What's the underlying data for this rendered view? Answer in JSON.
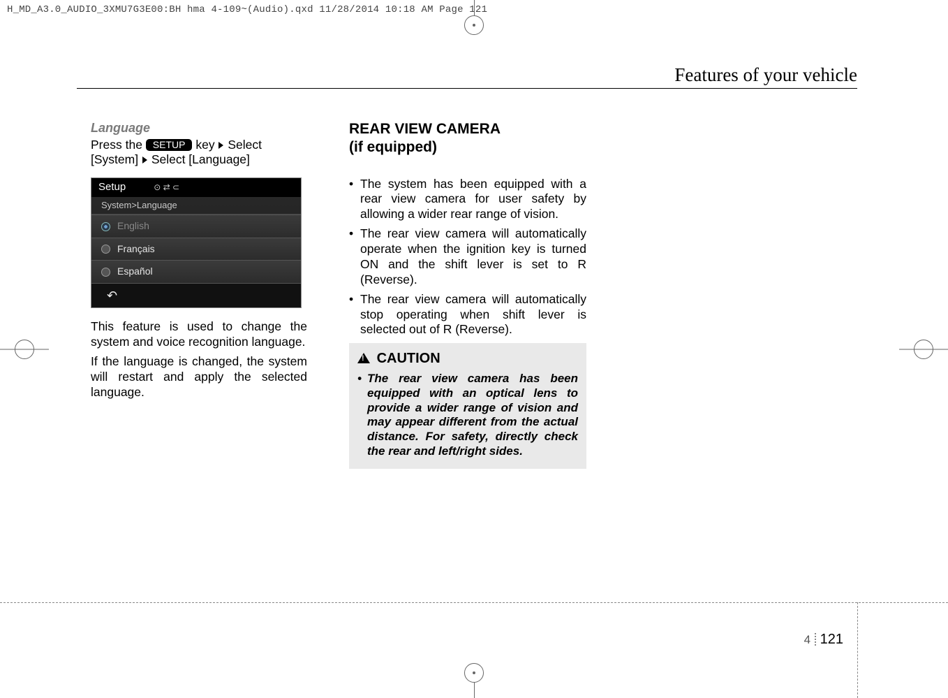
{
  "file_header": "H_MD_A3.0_AUDIO_3XMU7G3E00:BH hma 4-109~(Audio).qxd  11/28/2014  10:18 AM  Page 121",
  "section_title": "Features of your vehicle",
  "col1": {
    "lang_heading": "Language",
    "press_prefix": "Press  the ",
    "setup_label": "SETUP",
    "press_mid": " key",
    "press_suffix": "Select",
    "line2_a": "[System] ",
    "line2_b": "Select [Language]",
    "para1": "This feature is used to change the system and voice recognition language.",
    "para2": "If the language is changed, the system will restart and apply the selected language."
  },
  "screenshot": {
    "title": "Setup",
    "icons": "⊙    ⇄ ⊂",
    "breadcrumb": "System>Language",
    "rows": [
      "English",
      "Français",
      "Español"
    ],
    "back": "↶"
  },
  "col2": {
    "heading": "REAR VIEW CAMERA\n(if equipped)",
    "bullets": [
      "The system has been equipped with a rear view camera for user safety by allowing a wider rear range of vision.",
      "The rear view camera will automatically operate when the ignition key is turned ON and the shift lever is set to R (Reverse).",
      "The rear view camera will automatically stop operating when shift lever is selected out of R (Reverse)."
    ],
    "caution_label": "CAUTION",
    "caution_text": "The rear view camera has been equipped with an optical lens to provide a wider range of vision and may appear different from the actual distance. For safety, directly check the rear and left/right sides."
  },
  "page": {
    "section": "4",
    "number": "121"
  }
}
